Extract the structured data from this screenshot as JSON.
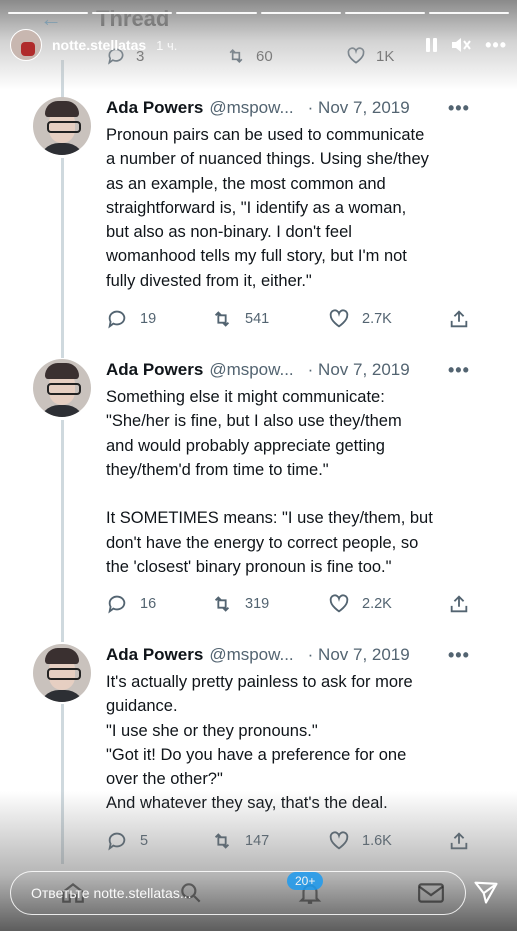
{
  "story": {
    "username": "notte.stellatas",
    "time": "1 ч.",
    "reply_placeholder": "Ответьте notte.stellatas..."
  },
  "thread_header": {
    "title": "Thread"
  },
  "top_tweet_actions": {
    "reply": "3",
    "retweet": "60",
    "like": "1K"
  },
  "tweets": [
    {
      "name": "Ada Powers",
      "handle": "@mspow...",
      "date": "· Nov 7, 2019",
      "text": "Pronoun pairs can be used to communicate\na number of nuanced things. Using she/they\nas an example, the most common and\nstraightforward is, \"I identify as a woman,\nbut also as non-binary. I don't feel\nwomanhood tells my full story, but I'm not\nfully divested from it, either.\"",
      "replies": "19",
      "retweets": "541",
      "likes": "2.7K"
    },
    {
      "name": "Ada Powers",
      "handle": "@mspow...",
      "date": "· Nov 7, 2019",
      "text": "Something else it might communicate:\n\"She/her is fine, but I also use they/them\nand would probably appreciate getting\nthey/them'd from time to time.\"\n\nIt SOMETIMES means: \"I use they/them, but\ndon't have the energy to correct people, so\nthe 'closest' binary pronoun is fine too.\"",
      "replies": "16",
      "retweets": "319",
      "likes": "2.2K"
    },
    {
      "name": "Ada Powers",
      "handle": "@mspow...",
      "date": "· Nov 7, 2019",
      "text": "It's actually pretty painless to ask for more\nguidance.\n\"I use she or they pronouns.\"\n\"Got it! Do you have a preference for one\nover the other?\"\nAnd whatever they say, that's the deal.",
      "replies": "5",
      "retweets": "147",
      "likes": "1.6K"
    }
  ],
  "notification_badge": "20+",
  "colors": {
    "accent": "#1d9bf0",
    "text": "#0f1419",
    "muted": "#536471"
  }
}
